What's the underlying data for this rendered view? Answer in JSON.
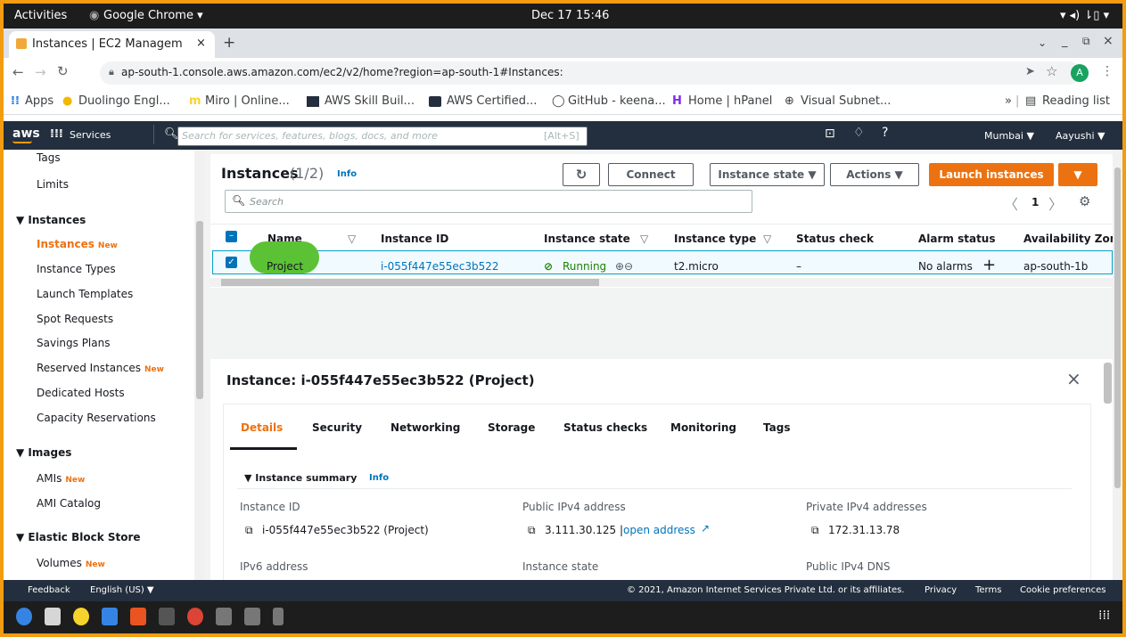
{
  "system_bar": {
    "activities": "Activities",
    "app": "Google Chrome ▾",
    "clock": "Dec 17  15:46",
    "tray": "▾  ◂)  ⇂▯  ▾"
  },
  "browser": {
    "tab_title": "Instances | EC2 Managem",
    "url": "ap-south-1.console.aws.amazon.com/ec2/v2/home?region=ap-south-1#Instances:",
    "avatar": "A",
    "bookmarks": [
      "Apps",
      "Duolingo Engl...",
      "Miro | Online...",
      "AWS Skill Buil...",
      "AWS Certified...",
      "GitHub - keena...",
      "Home | hPanel",
      "Visual Subnet..."
    ],
    "reading_list": "Reading list",
    "more": "»"
  },
  "aws_header": {
    "logo": "aws",
    "services": "Services",
    "search_placeholder": "Search for services, features, blogs, docs, and more",
    "shortcut": "[Alt+S]",
    "region": "Mumbai ▼",
    "user": "Aayushi ▼"
  },
  "sidebar": {
    "top_items": [
      "Tags",
      "Limits"
    ],
    "instances_section": "▼ Instances",
    "instances_items": [
      {
        "label": "Instances",
        "badge": "New"
      },
      {
        "label": "Instance Types",
        "badge": ""
      },
      {
        "label": "Launch Templates",
        "badge": ""
      },
      {
        "label": "Spot Requests",
        "badge": ""
      },
      {
        "label": "Savings Plans",
        "badge": ""
      },
      {
        "label": "Reserved Instances",
        "badge": "New"
      },
      {
        "label": "Dedicated Hosts",
        "badge": ""
      },
      {
        "label": "Capacity Reservations",
        "badge": ""
      }
    ],
    "images_section": "▼ Images",
    "images_items": [
      {
        "label": "AMIs",
        "badge": "New"
      },
      {
        "label": "AMI Catalog",
        "badge": ""
      }
    ],
    "ebs_section": "▼ Elastic Block Store",
    "ebs_items": [
      {
        "label": "Volumes",
        "badge": "New"
      }
    ]
  },
  "instances_panel": {
    "title": "Instances",
    "count": "(1/2)",
    "info": "Info",
    "connect": "Connect",
    "instance_state": "Instance state ▼",
    "actions": "Actions ▼",
    "launch": "Launch instances",
    "launch_caret": "▼",
    "search_placeholder": "Search",
    "page": "1",
    "columns": [
      "Name",
      "Instance ID",
      "Instance state",
      "Instance type",
      "Status check",
      "Alarm status",
      "Availability Zone"
    ],
    "row": {
      "name": "Project",
      "id": "i-055f447e55ec3b522",
      "state": "Running",
      "type": "t2.micro",
      "status_check": "–",
      "alarm": "No alarms",
      "az": "ap-south-1b"
    }
  },
  "detail_panel": {
    "title": "Instance: i-055f447e55ec3b522 (Project)",
    "tabs": [
      "Details",
      "Security",
      "Networking",
      "Storage",
      "Status checks",
      "Monitoring",
      "Tags"
    ],
    "summary": "▼ Instance summary",
    "summary_info": "Info",
    "fields": {
      "instance_id_label": "Instance ID",
      "instance_id": "i-055f447e55ec3b522 (Project)",
      "public_ip_label": "Public IPv4 address",
      "public_ip": "3.111.30.125 |",
      "open_address": "open address",
      "private_ip_label": "Private IPv4 addresses",
      "private_ip": "172.31.13.78",
      "ipv6_label": "IPv6 address",
      "state_label": "Instance state",
      "dns_label": "Public IPv4 DNS"
    }
  },
  "footer": {
    "feedback": "Feedback",
    "language": "English (US) ▼",
    "copyright": "© 2021, Amazon Internet Services Private Ltd. or its affiliates.",
    "privacy": "Privacy",
    "terms": "Terms",
    "cookies": "Cookie preferences"
  },
  "colors": {
    "aws_orange": "#ec7211",
    "aws_nav": "#232f3e",
    "link": "#0073bb",
    "running": "#1d8102",
    "highlight": "#5bc236"
  }
}
